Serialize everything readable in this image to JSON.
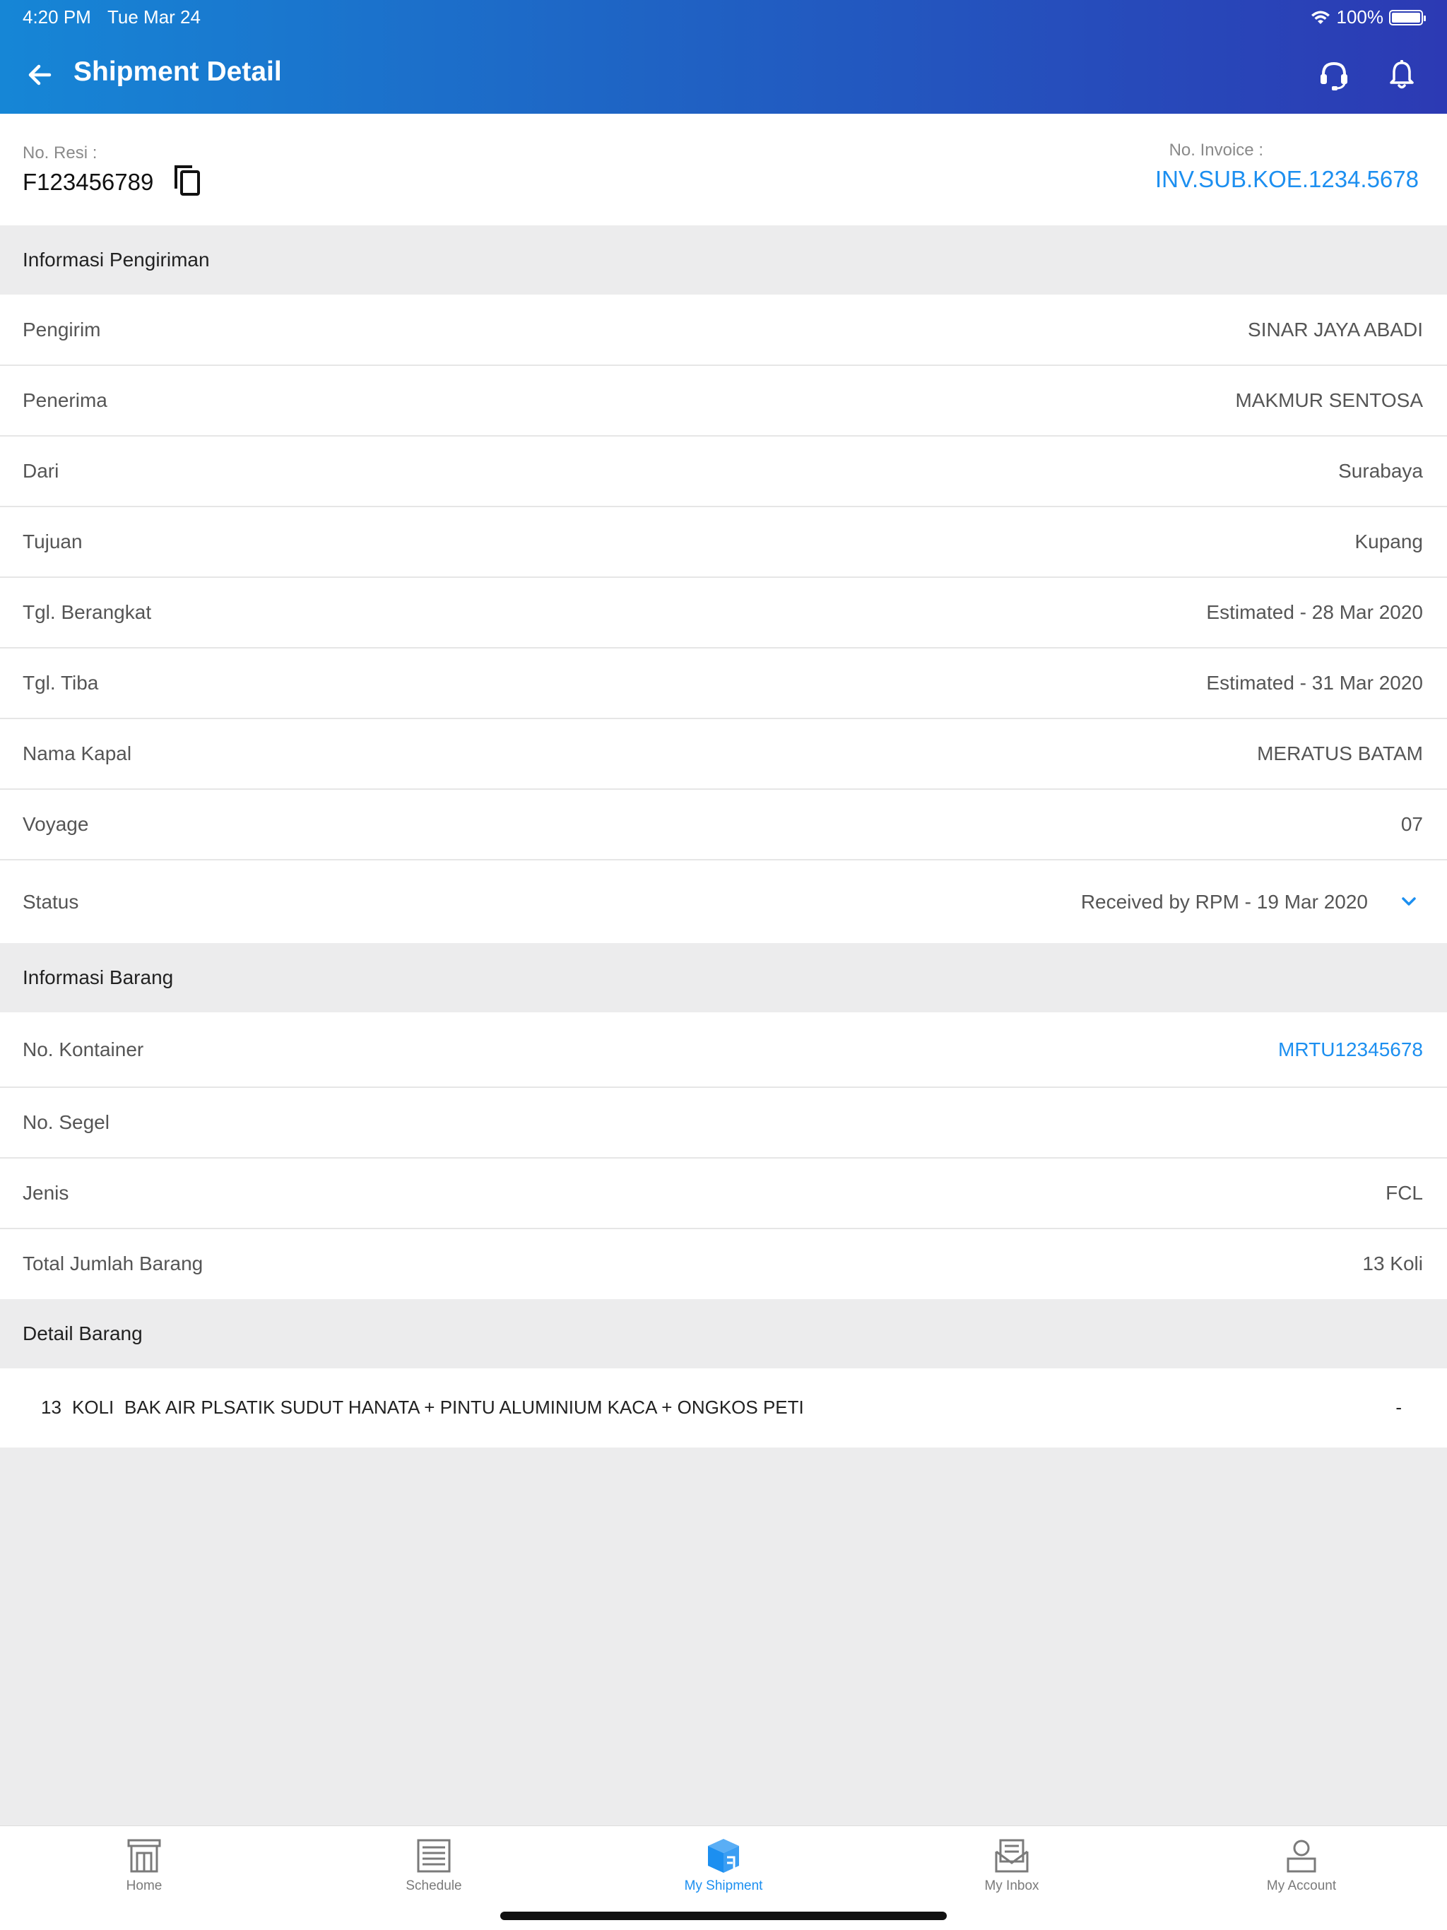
{
  "status_bar": {
    "time": "4:20 PM",
    "date": "Tue Mar 24",
    "battery": "100%"
  },
  "header": {
    "title": "Shipment Detail"
  },
  "reference": {
    "resi_label": "No. Resi :",
    "resi_value": "F123456789",
    "invoice_label": "No. Invoice :",
    "invoice_value": "INV.SUB.KOE.1234.5678"
  },
  "shipping_info": {
    "title": "Informasi Pengiriman",
    "rows": [
      {
        "label": "Pengirim",
        "value": "SINAR JAYA ABADI"
      },
      {
        "label": "Penerima",
        "value": "MAKMUR SENTOSA"
      },
      {
        "label": "Dari",
        "value": "Surabaya"
      },
      {
        "label": "Tujuan",
        "value": "Kupang"
      },
      {
        "label": "Tgl. Berangkat",
        "value": "Estimated - 28 Mar 2020"
      },
      {
        "label": "Tgl. Tiba",
        "value": "Estimated - 31 Mar 2020"
      },
      {
        "label": "Nama Kapal",
        "value": "MERATUS BATAM"
      },
      {
        "label": "Voyage",
        "value": "07"
      },
      {
        "label": "Status",
        "value": "Received by RPM - 19 Mar 2020"
      }
    ]
  },
  "goods_info": {
    "title": "Informasi Barang",
    "rows": [
      {
        "label": "No. Kontainer",
        "value": "MRTU12345678"
      },
      {
        "label": "No. Segel",
        "value": ""
      },
      {
        "label": "Jenis",
        "value": "FCL"
      },
      {
        "label": "Total Jumlah Barang",
        "value": "13 Koli"
      }
    ]
  },
  "goods_detail": {
    "title": "Detail Barang",
    "items": [
      {
        "qty": "13",
        "unit": "KOLI",
        "description": "BAK AIR PLSATIK SUDUT HANATA + PINTU ALUMINIUM KACA + ONGKOS PETI",
        "extra": "-"
      }
    ]
  },
  "nav": {
    "items": [
      {
        "label": "Home",
        "icon": "building-icon"
      },
      {
        "label": "Schedule",
        "icon": "schedule-list-icon"
      },
      {
        "label": "My Shipment",
        "icon": "package-box-icon"
      },
      {
        "label": "My Inbox",
        "icon": "inbox-icon"
      },
      {
        "label": "My Account",
        "icon": "person-icon"
      }
    ],
    "active": "My Shipment"
  },
  "colors": {
    "accent": "#1c8ff0",
    "header_start": "#1686d6",
    "header_end": "#2c3ab4"
  }
}
